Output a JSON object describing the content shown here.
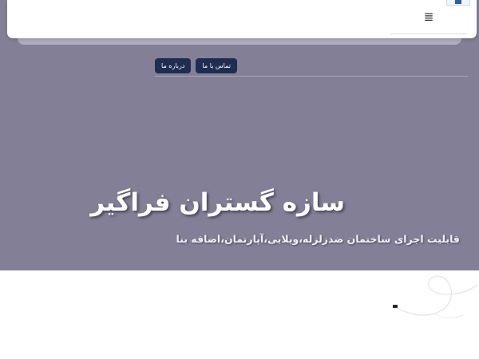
{
  "header": {
    "menu_icon": "hamburger-menu-icon",
    "menu_glyph": "≣",
    "thumb_icon": "thumbnail-icon"
  },
  "nav": {
    "items": [
      {
        "label": "درباره ما"
      },
      {
        "label": "تماس با ما"
      }
    ]
  },
  "hero": {
    "title": "سازه گستران فراگیر",
    "subtitle": "قابلیت اجرای ساختمان ضدزلزله،ویلایی،آپارتمان،اضافه بنا",
    "background_color": "#837f96"
  },
  "colors": {
    "nav_button": "#1f2d50",
    "hero_bg": "#837f96"
  },
  "decoration": {
    "icon": "curved-line-decoration-icon"
  }
}
